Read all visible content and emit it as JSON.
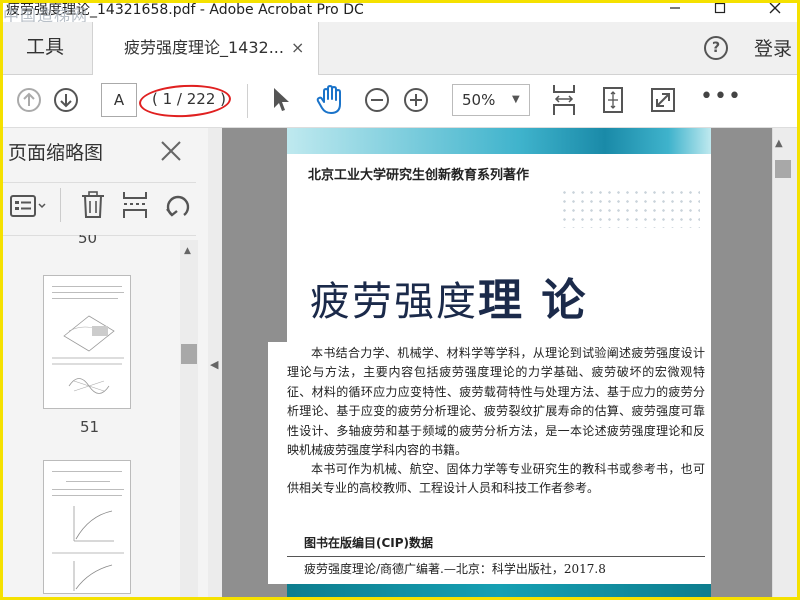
{
  "window": {
    "title": "疲劳强度理论_14321658.pdf - Adobe Acrobat Pro DC",
    "watermark": "中国造梯网"
  },
  "tabs": {
    "tools_label": "工具",
    "doc_label": "疲劳强度理论_1432...",
    "close_glyph": "×",
    "help_glyph": "?",
    "login_label": "登录"
  },
  "toolbar": {
    "page_input_value": "A",
    "page_count": "( 1 / 222 )",
    "zoom_value": "50%"
  },
  "thumbnail_pane": {
    "title": "页面缩略图",
    "page_numbers": [
      "50",
      "51"
    ]
  },
  "document": {
    "series": "北京工业大学研究生创新教育系列著作",
    "book_title_part1": "疲劳强度",
    "book_title_part2": "理 论",
    "paragraph1": "本书结合力学、机械学、材料学等学科，从理论到试验阐述疲劳强度设计理论与方法，主要内容包括疲劳强度理论的力学基础、疲劳破坏的宏微观特征、材料的循环应力应变特性、疲劳载荷特性与处理方法、基于应力的疲劳分析理论、基于应变的疲劳分析理论、疲劳裂纹扩展寿命的估算、疲劳强度可靠性设计、多轴疲劳和基于频域的疲劳分析方法，是一本论述疲劳强度理论和反映机械疲劳强度学科内容的书籍。",
    "paragraph2": "本书可作为机械、航空、固体力学等专业研究生的教科书或参考书，也可供相关专业的高校教师、工程设计人员和科技工作者参考。",
    "cip_heading": "图书在版编目(CIP)数据",
    "cip_line": "疲劳强度理论/商德广编著.—北京：科学出版社，2017.8"
  },
  "colors": {
    "highlight_frame": "#f5e100",
    "annotation_red": "#e02020",
    "hand_tool_blue": "#1a73c9",
    "cover_title": "#1b2a4a",
    "banner_teal": "#1a8aa8"
  }
}
